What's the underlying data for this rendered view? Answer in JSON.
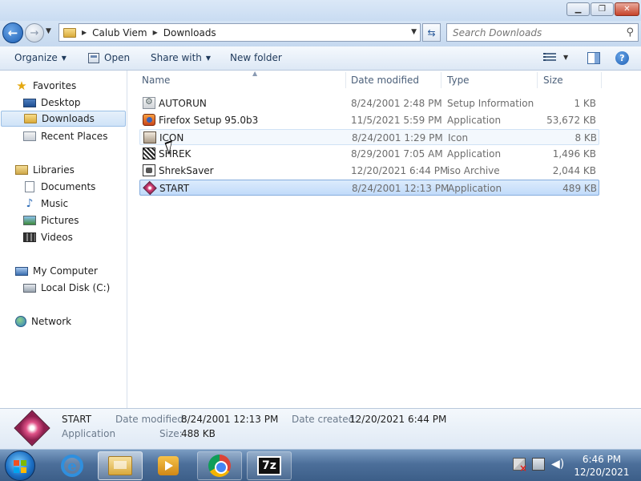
{
  "address": {
    "crumbs": [
      "Calub Viem",
      "Downloads"
    ],
    "search_placeholder": "Search Downloads"
  },
  "toolbar": {
    "organize": "Organize",
    "open": "Open",
    "share_with": "Share with",
    "new_folder": "New folder"
  },
  "nav": {
    "favorites": "Favorites",
    "desktop": "Desktop",
    "downloads": "Downloads",
    "recent": "Recent Places",
    "libraries": "Libraries",
    "documents": "Documents",
    "music": "Music",
    "pictures": "Pictures",
    "videos": "Videos",
    "computer": "My Computer",
    "local_disk": "Local Disk (C:)",
    "network": "Network"
  },
  "columns": {
    "name": "Name",
    "date": "Date modified",
    "type": "Type",
    "size": "Size"
  },
  "files": [
    {
      "name": "AUTORUN",
      "date": "8/24/2001 2:48 PM",
      "type": "Setup Information",
      "size": "1 KB"
    },
    {
      "name": "Firefox Setup 95.0b3",
      "date": "11/5/2021 5:59 PM",
      "type": "Application",
      "size": "53,672 KB"
    },
    {
      "name": "ICON",
      "date": "8/24/2001 1:29 PM",
      "type": "Icon",
      "size": "8 KB"
    },
    {
      "name": "SHREK",
      "date": "8/29/2001 7:05 AM",
      "type": "Application",
      "size": "1,496 KB"
    },
    {
      "name": "ShrekSaver",
      "date": "12/20/2021 6:44 PM",
      "type": "iso Archive",
      "size": "2,044 KB"
    },
    {
      "name": "START",
      "date": "8/24/2001 12:13 PM",
      "type": "Application",
      "size": "489 KB"
    }
  ],
  "details": {
    "name": "START",
    "type": "Application",
    "modified_label": "Date modified:",
    "modified_value": "8/24/2001 12:13 PM",
    "created_label": "Date created:",
    "created_value": "12/20/2021 6:44 PM",
    "size_label": "Size:",
    "size_value": "488 KB"
  },
  "taskbar": {
    "seven_zip": "7z",
    "time": "6:46 PM",
    "date": "12/20/2021"
  },
  "colors": {
    "selection": "#c1dbfa",
    "taskbar": "#4c6f9a"
  }
}
